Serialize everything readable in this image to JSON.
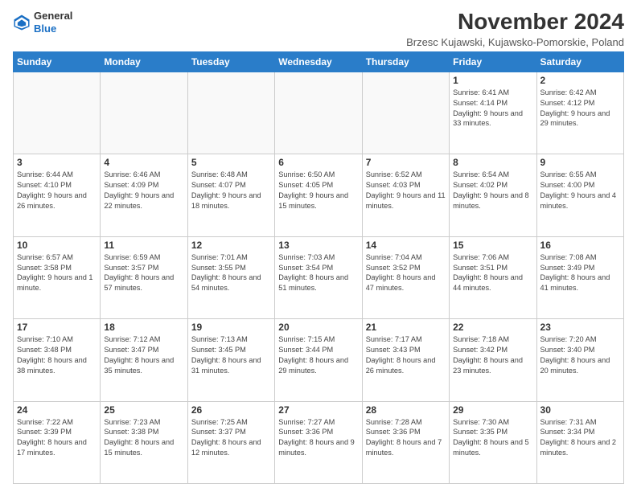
{
  "logo": {
    "general": "General",
    "blue": "Blue"
  },
  "header": {
    "title": "November 2024",
    "subtitle": "Brzesc Kujawski, Kujawsko-Pomorskie, Poland"
  },
  "days_of_week": [
    "Sunday",
    "Monday",
    "Tuesday",
    "Wednesday",
    "Thursday",
    "Friday",
    "Saturday"
  ],
  "weeks": [
    [
      {
        "day": "",
        "info": ""
      },
      {
        "day": "",
        "info": ""
      },
      {
        "day": "",
        "info": ""
      },
      {
        "day": "",
        "info": ""
      },
      {
        "day": "",
        "info": ""
      },
      {
        "day": "1",
        "info": "Sunrise: 6:41 AM\nSunset: 4:14 PM\nDaylight: 9 hours and 33 minutes."
      },
      {
        "day": "2",
        "info": "Sunrise: 6:42 AM\nSunset: 4:12 PM\nDaylight: 9 hours and 29 minutes."
      }
    ],
    [
      {
        "day": "3",
        "info": "Sunrise: 6:44 AM\nSunset: 4:10 PM\nDaylight: 9 hours and 26 minutes."
      },
      {
        "day": "4",
        "info": "Sunrise: 6:46 AM\nSunset: 4:09 PM\nDaylight: 9 hours and 22 minutes."
      },
      {
        "day": "5",
        "info": "Sunrise: 6:48 AM\nSunset: 4:07 PM\nDaylight: 9 hours and 18 minutes."
      },
      {
        "day": "6",
        "info": "Sunrise: 6:50 AM\nSunset: 4:05 PM\nDaylight: 9 hours and 15 minutes."
      },
      {
        "day": "7",
        "info": "Sunrise: 6:52 AM\nSunset: 4:03 PM\nDaylight: 9 hours and 11 minutes."
      },
      {
        "day": "8",
        "info": "Sunrise: 6:54 AM\nSunset: 4:02 PM\nDaylight: 9 hours and 8 minutes."
      },
      {
        "day": "9",
        "info": "Sunrise: 6:55 AM\nSunset: 4:00 PM\nDaylight: 9 hours and 4 minutes."
      }
    ],
    [
      {
        "day": "10",
        "info": "Sunrise: 6:57 AM\nSunset: 3:58 PM\nDaylight: 9 hours and 1 minute."
      },
      {
        "day": "11",
        "info": "Sunrise: 6:59 AM\nSunset: 3:57 PM\nDaylight: 8 hours and 57 minutes."
      },
      {
        "day": "12",
        "info": "Sunrise: 7:01 AM\nSunset: 3:55 PM\nDaylight: 8 hours and 54 minutes."
      },
      {
        "day": "13",
        "info": "Sunrise: 7:03 AM\nSunset: 3:54 PM\nDaylight: 8 hours and 51 minutes."
      },
      {
        "day": "14",
        "info": "Sunrise: 7:04 AM\nSunset: 3:52 PM\nDaylight: 8 hours and 47 minutes."
      },
      {
        "day": "15",
        "info": "Sunrise: 7:06 AM\nSunset: 3:51 PM\nDaylight: 8 hours and 44 minutes."
      },
      {
        "day": "16",
        "info": "Sunrise: 7:08 AM\nSunset: 3:49 PM\nDaylight: 8 hours and 41 minutes."
      }
    ],
    [
      {
        "day": "17",
        "info": "Sunrise: 7:10 AM\nSunset: 3:48 PM\nDaylight: 8 hours and 38 minutes."
      },
      {
        "day": "18",
        "info": "Sunrise: 7:12 AM\nSunset: 3:47 PM\nDaylight: 8 hours and 35 minutes."
      },
      {
        "day": "19",
        "info": "Sunrise: 7:13 AM\nSunset: 3:45 PM\nDaylight: 8 hours and 31 minutes."
      },
      {
        "day": "20",
        "info": "Sunrise: 7:15 AM\nSunset: 3:44 PM\nDaylight: 8 hours and 29 minutes."
      },
      {
        "day": "21",
        "info": "Sunrise: 7:17 AM\nSunset: 3:43 PM\nDaylight: 8 hours and 26 minutes."
      },
      {
        "day": "22",
        "info": "Sunrise: 7:18 AM\nSunset: 3:42 PM\nDaylight: 8 hours and 23 minutes."
      },
      {
        "day": "23",
        "info": "Sunrise: 7:20 AM\nSunset: 3:40 PM\nDaylight: 8 hours and 20 minutes."
      }
    ],
    [
      {
        "day": "24",
        "info": "Sunrise: 7:22 AM\nSunset: 3:39 PM\nDaylight: 8 hours and 17 minutes."
      },
      {
        "day": "25",
        "info": "Sunrise: 7:23 AM\nSunset: 3:38 PM\nDaylight: 8 hours and 15 minutes."
      },
      {
        "day": "26",
        "info": "Sunrise: 7:25 AM\nSunset: 3:37 PM\nDaylight: 8 hours and 12 minutes."
      },
      {
        "day": "27",
        "info": "Sunrise: 7:27 AM\nSunset: 3:36 PM\nDaylight: 8 hours and 9 minutes."
      },
      {
        "day": "28",
        "info": "Sunrise: 7:28 AM\nSunset: 3:36 PM\nDaylight: 8 hours and 7 minutes."
      },
      {
        "day": "29",
        "info": "Sunrise: 7:30 AM\nSunset: 3:35 PM\nDaylight: 8 hours and 5 minutes."
      },
      {
        "day": "30",
        "info": "Sunrise: 7:31 AM\nSunset: 3:34 PM\nDaylight: 8 hours and 2 minutes."
      }
    ]
  ]
}
